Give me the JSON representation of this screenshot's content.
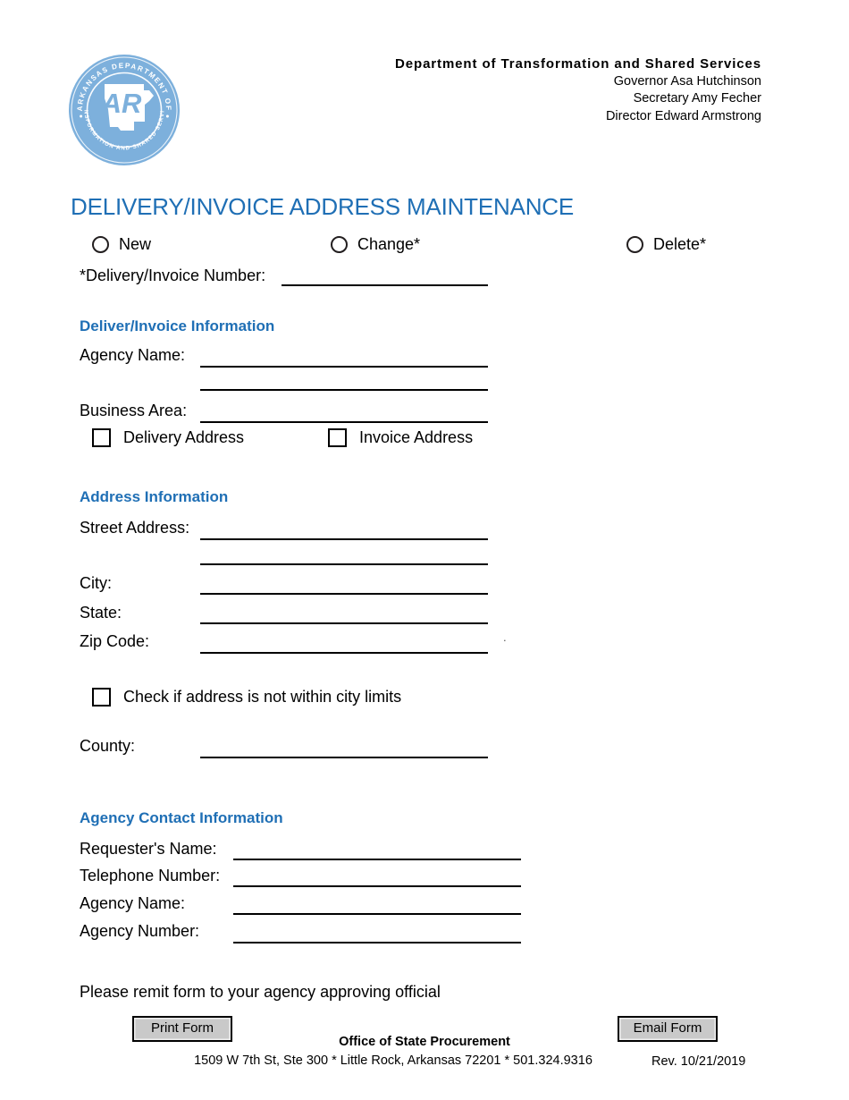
{
  "header": {
    "seal": {
      "top_arc_text": "ARKANSAS DEPARTMENT OF",
      "bottom_arc_text": "TRANSFORMATION AND SHARED SERVICES",
      "center_monogram": "AR",
      "color": "#7DB0DC"
    },
    "department_title": "Department of Transformation and Shared Services",
    "officials": [
      "Governor Asa Hutchinson",
      "Secretary Amy Fecher",
      "Director Edward Armstrong"
    ]
  },
  "form": {
    "title": "DELIVERY/INVOICE ADDRESS MAINTENANCE",
    "title_color": "#1F6FB5",
    "action_options": [
      {
        "label": "New",
        "selected": false
      },
      {
        "label": "Change*",
        "selected": false
      },
      {
        "label": "Delete*",
        "selected": false
      }
    ],
    "delivery_invoice_number": {
      "label": "*Delivery/Invoice Number:",
      "value": ""
    }
  },
  "deliver_invoice_information": {
    "heading": "Deliver/Invoice Information",
    "fields": [
      {
        "label": "Agency Name:",
        "value": ""
      },
      {
        "label": "",
        "value": ""
      },
      {
        "label": "Business Area:",
        "value": ""
      }
    ],
    "checkboxes": [
      {
        "label": "Delivery Address",
        "checked": false
      },
      {
        "label": "Invoice Address",
        "checked": false
      }
    ]
  },
  "address_information": {
    "heading": "Address Information",
    "fields": [
      {
        "label": "Street Address:",
        "value": ""
      },
      {
        "label": "",
        "value": ""
      },
      {
        "label": "City:",
        "value": ""
      },
      {
        "label": "State:",
        "value": ""
      },
      {
        "label": "Zip Code:",
        "value": ""
      }
    ],
    "trailing_mark": ".",
    "city_limits_checkbox": {
      "label": "Check if address is not within city limits",
      "checked": false
    },
    "county_field": {
      "label": "County:",
      "value": ""
    }
  },
  "agency_contact_information": {
    "heading": "Agency Contact Information",
    "fields": [
      {
        "label": "Requester's Name:",
        "value": ""
      },
      {
        "label": "Telephone Number:",
        "value": ""
      },
      {
        "label": "Agency Name:",
        "value": ""
      },
      {
        "label": "Agency Number:",
        "value": ""
      }
    ]
  },
  "footer": {
    "remit_note": "Please remit form to your agency approving official",
    "print_button": "Print Form",
    "email_button": "Email Form",
    "office_name": "Office of State Procurement",
    "office_address": "1509 W 7th St, Ste 300 * Little Rock, Arkansas 72201 * 501.324.9316",
    "revision": "Rev. 10/21/2019"
  }
}
